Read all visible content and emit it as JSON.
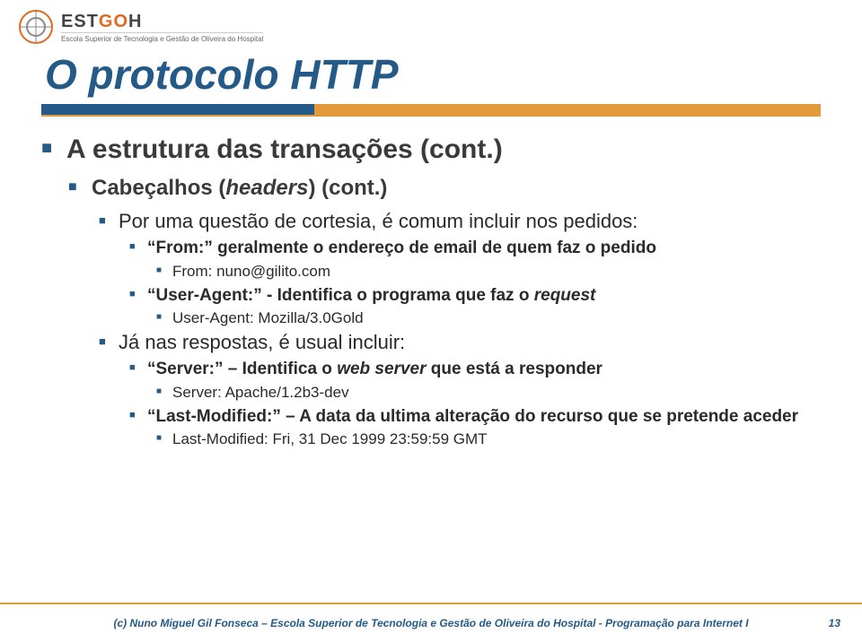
{
  "logo": {
    "word_est": "EST",
    "word_go": "GO",
    "word_h": "H",
    "subtitle": "Escola Superior de Tecnologia e Gestão de Oliveira do Hospital"
  },
  "title": "O protocolo HTTP",
  "bullets": {
    "l1": "A estrutura das transações (cont.)",
    "l2a": "Cabeçalhos (",
    "l2a_em": "headers",
    "l2a_end": ") (cont.)",
    "l3a": "Por uma questão de cortesia, é comum incluir nos pedidos:",
    "l4a_pre": "“From:”",
    "l4a_rest": " geralmente o endereço de email de quem faz o pedido",
    "l5a": "From: nuno@gilito.com",
    "l4b_pre": "“User-Agent:” - ",
    "l4b_rest": "Identifica o programa que faz o ",
    "l4b_em": "request",
    "l5b": "User-Agent: Mozilla/3.0Gold",
    "l3b": "Já nas respostas, é usual incluir:",
    "l4c_pre": "“Server:”",
    "l4c_mid": " – Identifica o ",
    "l4c_em": "web server",
    "l4c_end": " que está a responder",
    "l5c": "Server: Apache/1.2b3-dev",
    "l4d_pre": "“Last-Modified:”",
    "l4d_rest": " – A data da ultima alteração do recurso que se pretende aceder",
    "l5d": "Last-Modified: Fri, 31 Dec 1999 23:59:59 GMT"
  },
  "footer": {
    "text": "(c) Nuno Miguel Gil Fonseca  –  Escola Superior de Tecnologia e Gestão de Oliveira do Hospital  -  Programação para Internet I",
    "page": "13"
  }
}
